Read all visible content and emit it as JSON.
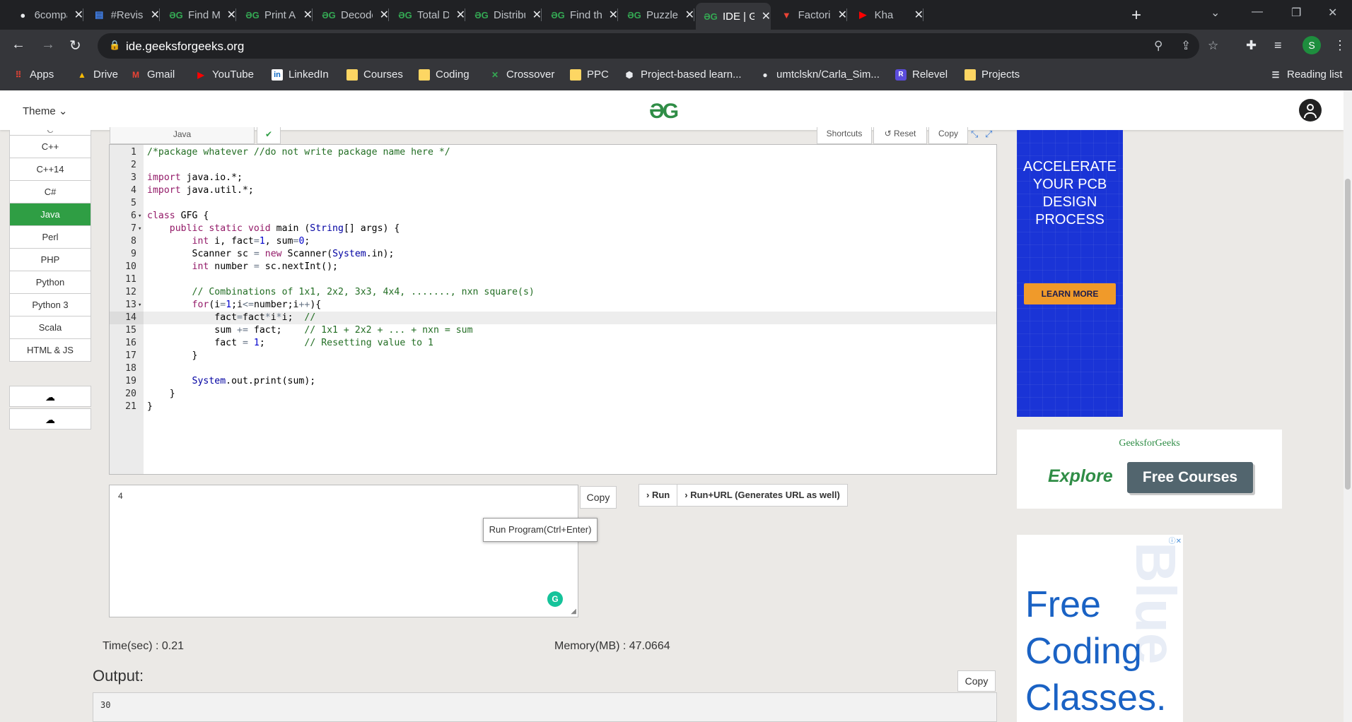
{
  "browser": {
    "tabs": [
      {
        "title": "6compa",
        "icon": "github-icon"
      },
      {
        "title": "#Revise",
        "icon": "google-docs-icon"
      },
      {
        "title": "Find Mi",
        "icon": "gfg-icon"
      },
      {
        "title": "Print Ar",
        "icon": "gfg-icon"
      },
      {
        "title": "Decode",
        "icon": "gfg-icon"
      },
      {
        "title": "Total D",
        "icon": "gfg-icon"
      },
      {
        "title": "Distribu",
        "icon": "gfg-icon"
      },
      {
        "title": "Find th",
        "icon": "gfg-icon"
      },
      {
        "title": "Puzzle |",
        "icon": "gfg-icon"
      },
      {
        "title": "IDE | Ge",
        "icon": "gfg-icon",
        "active": true
      },
      {
        "title": "Factoria",
        "icon": "vedantu-icon"
      },
      {
        "title": "Kha",
        "icon": "youtube-icon"
      }
    ],
    "url": "ide.geeksforgeeks.org",
    "profile_initial": "S",
    "reading_list": "Reading list",
    "bookmarks": [
      {
        "label": "Apps",
        "icon": "apps-grid-icon"
      },
      {
        "label": "Drive",
        "icon": "drive-icon"
      },
      {
        "label": "Gmail",
        "icon": "gmail-icon"
      },
      {
        "label": "YouTube",
        "icon": "youtube-icon"
      },
      {
        "label": "LinkedIn",
        "icon": "linkedin-icon"
      },
      {
        "label": "Courses",
        "icon": "folder-icon"
      },
      {
        "label": "Coding",
        "icon": "folder-icon"
      },
      {
        "label": "Crossover",
        "icon": "crossover-icon"
      },
      {
        "label": "PPC",
        "icon": "folder-icon"
      },
      {
        "label": "Project-based learn...",
        "icon": "project-icon"
      },
      {
        "label": "umtclskn/Carla_Sim...",
        "icon": "github-icon"
      },
      {
        "label": "Relevel",
        "icon": "relevel-icon"
      },
      {
        "label": "Projects",
        "icon": "folder-icon"
      }
    ]
  },
  "site": {
    "theme_label": "Theme",
    "logo": "ƏG"
  },
  "languages": [
    "C",
    "C++",
    "C++14",
    "C#",
    "Java",
    "Perl",
    "PHP",
    "Python",
    "Python 3",
    "Scala",
    "HTML & JS"
  ],
  "active_language": "Java",
  "editor": {
    "tab_label": "Java",
    "shortcuts_label": "Shortcuts",
    "reset_label": "Reset",
    "copy_label": "Copy",
    "highlighted_line": 14
  },
  "input": {
    "value": "4",
    "copy_label": "Copy"
  },
  "run": {
    "run_label": "Run",
    "run_url_label": "Run+URL (Generates URL as well)",
    "tooltip": "Run Program(Ctrl+Enter)"
  },
  "stats": {
    "time": "Time(sec) : 0.21",
    "memory": "Memory(MB) : 47.0664"
  },
  "output": {
    "label": "Output:",
    "value": "30",
    "copy_label": "Copy"
  },
  "ads": {
    "pcb": {
      "heading": "ACCELERATE YOUR PCB DESIGN PROCESS",
      "button": "LEARN MORE"
    },
    "gfg": {
      "brand": "GeeksforGeeks",
      "explore": "Explore",
      "button": "Free Courses"
    },
    "coding": {
      "line1": "Free",
      "line2": "Coding",
      "line3": "Classes.",
      "bg_text": "Blue"
    }
  },
  "colors": {
    "gfg_green": "#2f8d46",
    "active_language_bg": "#2f9e44"
  }
}
